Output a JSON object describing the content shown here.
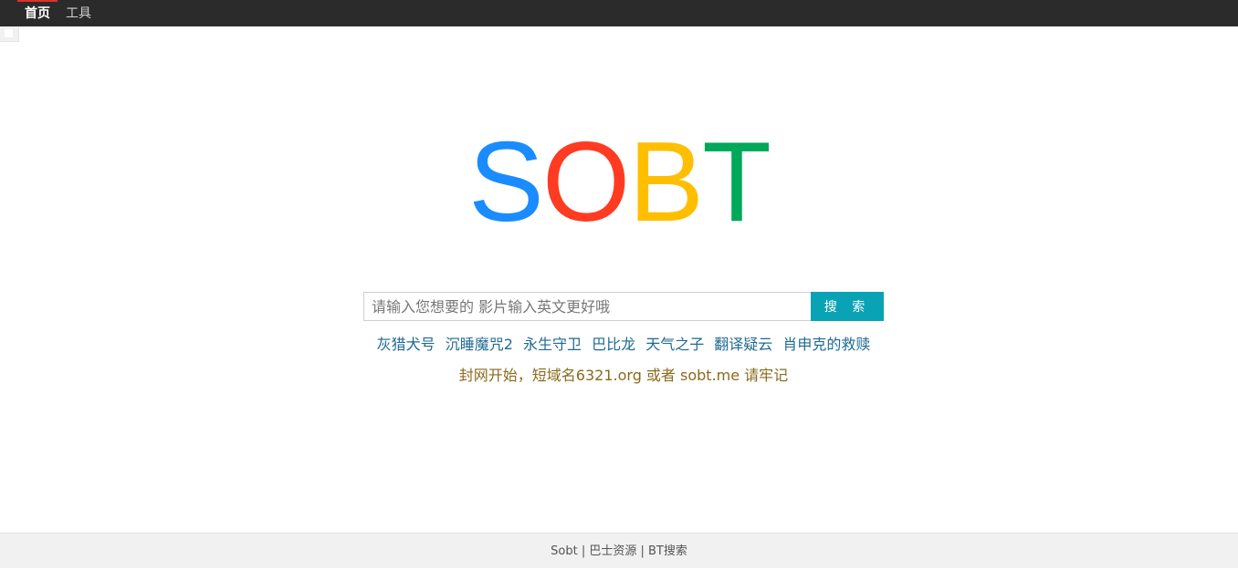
{
  "nav": {
    "home": "首页",
    "tools": "工具"
  },
  "logo": {
    "letters": [
      {
        "char": "S",
        "color": "#1a8cff"
      },
      {
        "char": "O",
        "color": "#ff3b22"
      },
      {
        "char": "B",
        "color": "#ffbe00"
      },
      {
        "char": "T",
        "color": "#00a859"
      }
    ]
  },
  "search": {
    "placeholder": "请输入您想要的 影片输入英文更好哦",
    "value": "",
    "button_label": "搜 索"
  },
  "hot_links": [
    "灰猎犬号",
    "沉睡魔咒2",
    "永生守卫",
    "巴比龙",
    "天气之子",
    "翻译疑云",
    "肖申克的救赎"
  ],
  "notice": "封网开始，短域名6321.org 或者 sobt.me 请牢记",
  "footer": "Sobt | 巴士资源 | BT搜索",
  "colors": {
    "topbar": "#2b2b2b",
    "accent": "#0aa3b5",
    "link": "#1f6a92",
    "notice": "#8a6a1c"
  }
}
